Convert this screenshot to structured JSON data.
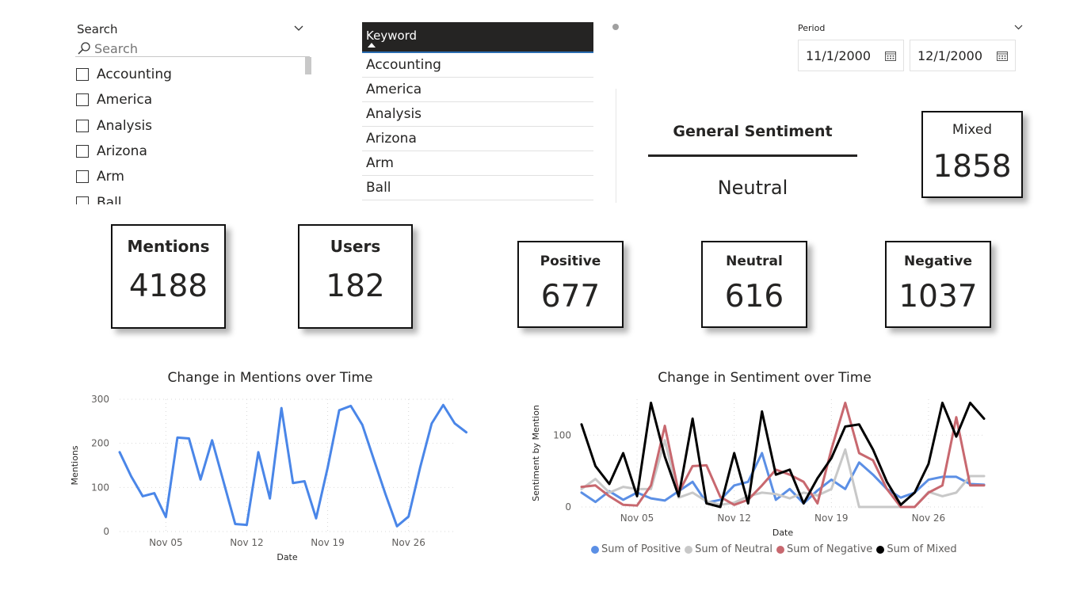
{
  "slicer": {
    "title": "Search",
    "search_placeholder": "Search",
    "items": [
      "Accounting",
      "America",
      "Analysis",
      "Arizona",
      "Arm",
      "Ball"
    ]
  },
  "keyword_table": {
    "header": "Keyword",
    "rows": [
      "Accounting",
      "America",
      "Analysis",
      "Arizona",
      "Arm",
      "Ball"
    ]
  },
  "period": {
    "label": "Period",
    "start": "11/1/2000",
    "end": "12/1/2000"
  },
  "general_sentiment": {
    "title": "General Sentiment",
    "value": "Neutral"
  },
  "cards": {
    "mixed": {
      "label": "Mixed",
      "value": "1858"
    },
    "mentions": {
      "label": "Mentions",
      "value": "4188"
    },
    "users": {
      "label": "Users",
      "value": "182"
    },
    "positive": {
      "label": "Positive",
      "value": "677"
    },
    "neutral": {
      "label": "Neutral",
      "value": "616"
    },
    "negative": {
      "label": "Negative",
      "value": "1037"
    }
  },
  "chart_data": [
    {
      "type": "line",
      "title": "Change in Mentions over Time",
      "xlabel": "Date",
      "ylabel": "Mentions",
      "x_start": "2000-11-01",
      "x_end": "2000-11-30",
      "xticks": [
        "Nov 05",
        "Nov 12",
        "Nov 19",
        "Nov 26"
      ],
      "ylim": [
        0,
        300
      ],
      "yticks": [
        0,
        100,
        200,
        300
      ],
      "grid": true,
      "color": "#4a86e8",
      "series": [
        {
          "values": [
            180,
            125,
            80,
            87,
            33,
            213,
            211,
            118,
            207,
            112,
            17,
            15,
            180,
            75,
            280,
            110,
            114,
            30,
            145,
            275,
            285,
            242,
            163,
            85,
            12,
            34,
            145,
            245,
            287,
            245,
            225
          ]
        }
      ]
    },
    {
      "type": "line",
      "title": "Change in Sentiment over Time",
      "xlabel": "Date",
      "ylabel": "Sentiment by Mention",
      "x_start": "2000-11-01",
      "x_end": "2000-11-30",
      "xticks": [
        "Nov 05",
        "Nov 12",
        "Nov 19",
        "Nov 26"
      ],
      "ylim": [
        0,
        150
      ],
      "yticks": [
        0,
        100
      ],
      "grid": true,
      "legend_position": "bottom",
      "series": [
        {
          "name": "Sum of Positive",
          "color": "#5b8fe5",
          "values": [
            20,
            7,
            22,
            10,
            20,
            12,
            9,
            22,
            35,
            6,
            10,
            30,
            35,
            75,
            10,
            25,
            5,
            23,
            38,
            25,
            62,
            45,
            25,
            13,
            20,
            38,
            42,
            42,
            32,
            31
          ]
        },
        {
          "name": "Sum of Neutral",
          "color": "#c8c8c8",
          "values": [
            25,
            39,
            20,
            28,
            25,
            25,
            93,
            13,
            20,
            8,
            3,
            6,
            15,
            20,
            18,
            12,
            20,
            16,
            25,
            80,
            0,
            0,
            0,
            0,
            0,
            21,
            15,
            20,
            43,
            43
          ]
        },
        {
          "name": "Sum of Negative",
          "color": "#c8686f",
          "values": [
            28,
            30,
            15,
            3,
            2,
            30,
            113,
            20,
            57,
            58,
            14,
            3,
            10,
            30,
            52,
            45,
            35,
            5,
            80,
            145,
            75,
            65,
            25,
            0,
            0,
            20,
            30,
            125,
            30,
            30
          ]
        },
        {
          "name": "Sum of Mixed",
          "color": "#000000",
          "values": [
            115,
            57,
            32,
            75,
            15,
            145,
            70,
            15,
            123,
            5,
            0,
            75,
            5,
            133,
            45,
            52,
            5,
            40,
            68,
            112,
            115,
            80,
            35,
            3,
            20,
            60,
            145,
            98,
            145,
            123
          ]
        }
      ]
    }
  ]
}
